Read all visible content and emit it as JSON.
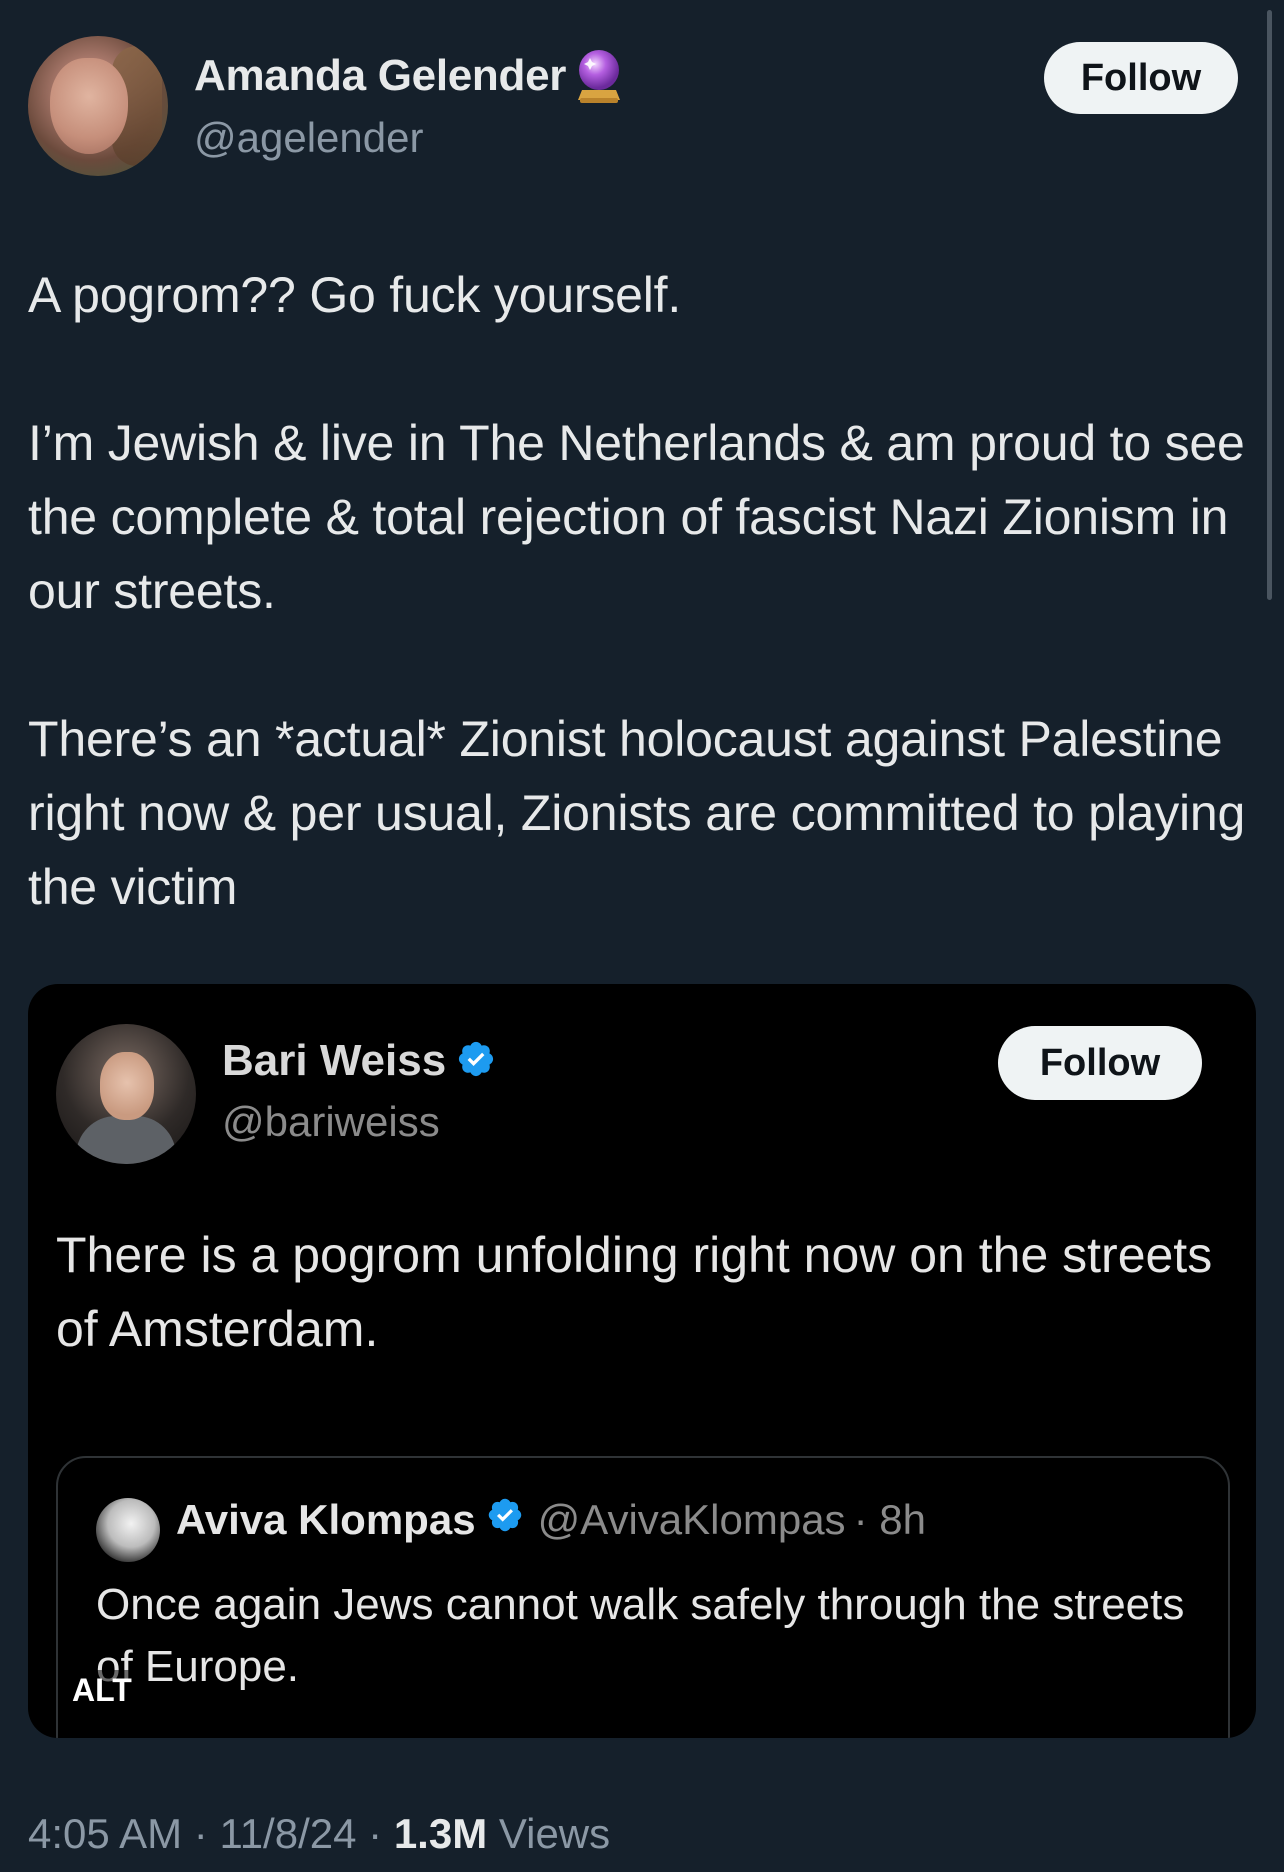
{
  "author": {
    "display_name": "Amanda Gelender",
    "handle": "@agelender",
    "badge_emoji": "crystal-ball",
    "follow_label": "Follow"
  },
  "tweet": {
    "paragraphs": [
      "A pogrom?? Go fuck yourself.",
      "I’m Jewish & live in The Netherlands & am proud to see the complete & total rejection of fascist Nazi Zionism in our streets.",
      "There’s an *actual* Zionist holocaust against Palestine right now & per usual, Zionists are committed to playing the victim"
    ]
  },
  "quoted": {
    "display_name": "Bari Weiss",
    "handle": "@bariweiss",
    "follow_label": "Follow",
    "text": "There is a pogrom unfolding right now on the streets of Amsterdam.",
    "inner": {
      "display_name": "Aviva Klompas",
      "handle": "@AvivaKlompas",
      "time": "· 8h",
      "text": "Once again Jews cannot walk safely through the streets of Europe."
    },
    "alt_label": "ALT"
  },
  "footer": {
    "time": "4:05 AM",
    "date": "11/8/24",
    "separator": "·",
    "views_count": "1.3M",
    "views_label": "Views"
  },
  "colors": {
    "background": "#15202b",
    "text": "#e7e9ea",
    "muted": "#8b98a5",
    "verified": "#1d9bf0",
    "media_bg": "#000000"
  }
}
